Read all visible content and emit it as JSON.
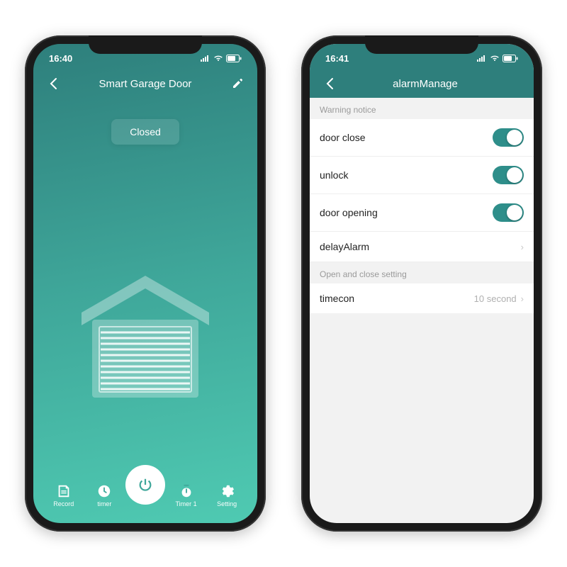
{
  "left": {
    "status": {
      "time": "16:40"
    },
    "nav": {
      "title": "Smart Garage Door"
    },
    "state": {
      "label": "Closed"
    },
    "bottom": {
      "record": "Record",
      "timer": "timer",
      "timer1": "Timer 1",
      "setting": "Setting"
    }
  },
  "right": {
    "status": {
      "time": "16:41"
    },
    "nav": {
      "title": "alarmManage"
    },
    "sections": {
      "warning": "Warning notice",
      "openclose": "Open and close setting"
    },
    "rows": {
      "door_close": {
        "label": "door close",
        "on": true
      },
      "unlock": {
        "label": "unlock",
        "on": true
      },
      "door_opening": {
        "label": "door opening",
        "on": true
      },
      "delay_alarm": {
        "label": "delayAlarm"
      },
      "timecon": {
        "label": "timecon",
        "value": "10 second"
      }
    }
  }
}
